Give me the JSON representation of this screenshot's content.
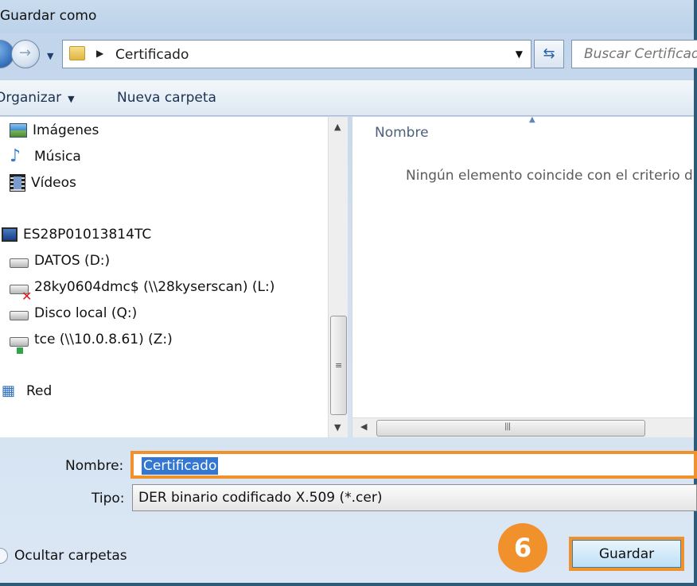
{
  "window": {
    "title": "Guardar como"
  },
  "address": {
    "crumb": "Certificado"
  },
  "search": {
    "placeholder": "Buscar Certificado"
  },
  "toolbar": {
    "organize_label": "Organizar",
    "new_folder_label": "Nueva carpeta"
  },
  "navpane": {
    "items": [
      {
        "label": "Imágenes",
        "icon": "pictures-icon"
      },
      {
        "label": "Música",
        "icon": "music-icon"
      },
      {
        "label": "Vídeos",
        "icon": "videos-icon"
      },
      {
        "label": "ES28P01013814TC",
        "icon": "computer-icon"
      },
      {
        "label": "DATOS (D:)",
        "icon": "drive-icon"
      },
      {
        "label": "28ky0604dmc$ (\\\\28kyserscan) (L:)",
        "icon": "disconnected-network-drive-icon"
      },
      {
        "label": "Disco local (Q:)",
        "icon": "drive-icon"
      },
      {
        "label": "tce (\\\\10.0.8.61) (Z:)",
        "icon": "network-drive-icon"
      },
      {
        "label": "Red",
        "icon": "network-icon"
      }
    ]
  },
  "filelist": {
    "column_name": "Nombre",
    "empty_message": "Ningún elemento coincide con el criterio d"
  },
  "form": {
    "name_label": "Nombre:",
    "name_value": "Certificado",
    "type_label": "Tipo:",
    "type_value": "DER binario codificado X.509 (*.cer)"
  },
  "footer": {
    "hide_folders_label": "Ocultar carpetas",
    "save_label": "Guardar",
    "step_number": "6"
  },
  "colors": {
    "highlight": "#f0912c",
    "selection": "#3377d1"
  }
}
